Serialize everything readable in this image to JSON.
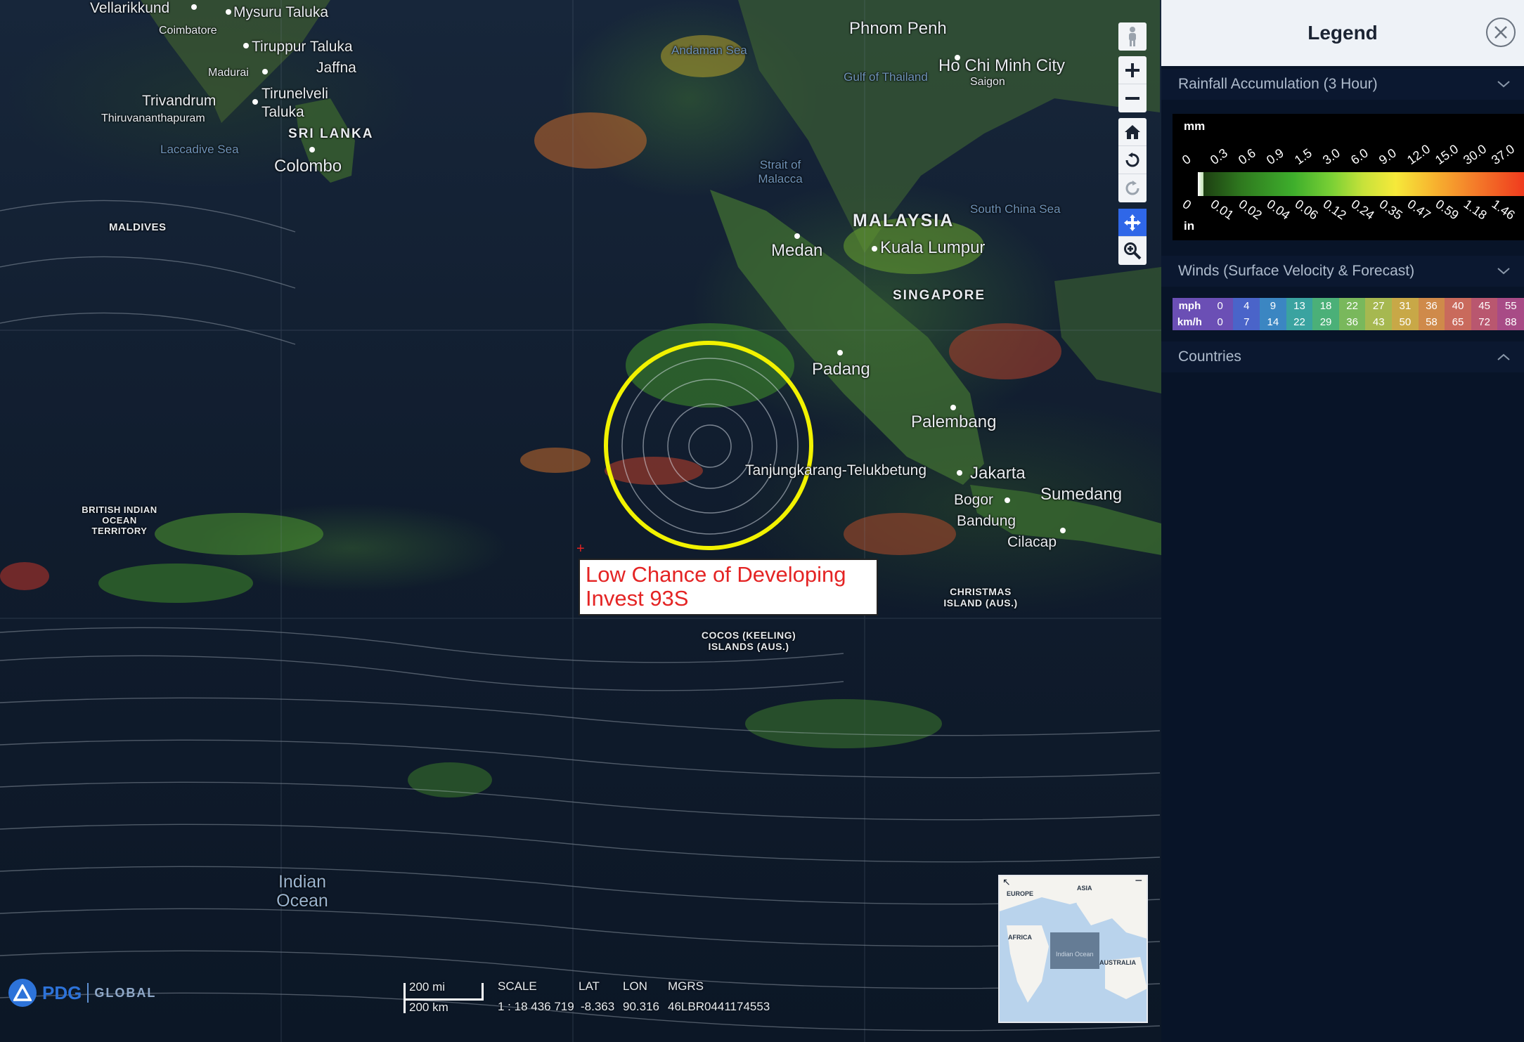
{
  "map": {
    "places": [
      {
        "id": "vellarikkund",
        "text": "Vellarikkund"
      },
      {
        "id": "mysuru",
        "text": "Mysuru Taluka"
      },
      {
        "id": "coimbatore",
        "text": "Coimbatore"
      },
      {
        "id": "tiruppur",
        "text": "Tiruppur Taluka"
      },
      {
        "id": "jaffna",
        "text": "Jaffna"
      },
      {
        "id": "madurai",
        "text": "Madurai"
      },
      {
        "id": "trivandrum",
        "text": "Trivandrum"
      },
      {
        "id": "thiruvananthapuram",
        "text": "Thiruvananthapuram"
      },
      {
        "id": "tirunelveli",
        "text": "Tirunelveli"
      },
      {
        "id": "taluka",
        "text": "Taluka"
      },
      {
        "id": "srilanka",
        "text": "SRI LANKA"
      },
      {
        "id": "laccadive",
        "text": "Laccadive Sea"
      },
      {
        "id": "colombo",
        "text": "Colombo"
      },
      {
        "id": "maldives",
        "text": "MALDIVES"
      },
      {
        "id": "biot",
        "text": "BRITISH INDIAN OCEAN TERRITORY"
      },
      {
        "id": "phnompenh",
        "text": "Phnom Penh"
      },
      {
        "id": "hochiminh",
        "text": "Ho Chi Minh City"
      },
      {
        "id": "saigon",
        "text": "Saigon"
      },
      {
        "id": "andaman",
        "text": "Andaman Sea"
      },
      {
        "id": "gulfthailand",
        "text": "Gulf of Thailand"
      },
      {
        "id": "malacca",
        "text": "Strait of Malacca"
      },
      {
        "id": "malaysia",
        "text": "MALAYSIA"
      },
      {
        "id": "southchinasea",
        "text": "South China Sea"
      },
      {
        "id": "medan",
        "text": "Medan"
      },
      {
        "id": "kualalumpur",
        "text": "Kuala Lumpur"
      },
      {
        "id": "singapore",
        "text": "SINGAPORE"
      },
      {
        "id": "padang",
        "text": "Padang"
      },
      {
        "id": "palembang",
        "text": "Palembang"
      },
      {
        "id": "tanjung",
        "text": "Tanjungkarang-Telukbetung"
      },
      {
        "id": "jakarta",
        "text": "Jakarta"
      },
      {
        "id": "sumedang",
        "text": "Sumedang"
      },
      {
        "id": "bogor",
        "text": "Bogor"
      },
      {
        "id": "bandung",
        "text": "Bandung"
      },
      {
        "id": "cilacap",
        "text": "Cilacap"
      },
      {
        "id": "christmas",
        "text": "CHRISTMAS ISLAND (AUS.)"
      },
      {
        "id": "cocos",
        "text": "COCOS (KEELING) ISLANDS (AUS.)"
      },
      {
        "id": "indianocean",
        "text": "Indian Ocean"
      }
    ],
    "annotation": {
      "line1": "Low Chance of Developing",
      "line2": "Invest 93S",
      "color": "#e42424"
    },
    "storm_circle_color": "#f2f200",
    "toolbar": [
      "person-icon",
      "zoom-in-icon",
      "zoom-out-icon",
      "home-icon",
      "rotate-left-icon",
      "rotate-right-icon",
      "pan-icon",
      "zoom-box-icon"
    ],
    "scale": {
      "mi": "200 mi",
      "km": "200 km",
      "scale_label": "SCALE",
      "scale_value": "1 : 18 436 719"
    },
    "coords": {
      "lat_label": "LAT",
      "lat": "-8.363",
      "lon_label": "LON",
      "lon": "90.316",
      "mgrs_label": "MGRS",
      "mgrs": "46LBR0441174553"
    },
    "logo": {
      "pdg": "PDG",
      "global": "GLOBAL"
    },
    "overview": {
      "europe": "EUROPE",
      "asia": "ASIA",
      "africa": "AFRICA",
      "indian_ocean": "Indian Ocean",
      "australia": "AUSTRALIA"
    }
  },
  "legend": {
    "title": "Legend",
    "sections": [
      {
        "label": "Rainfall Accumulation (3 Hour)",
        "state": "expanded"
      },
      {
        "label": "Winds (Surface Velocity & Forecast)",
        "state": "expanded"
      },
      {
        "label": "Countries",
        "state": "collapsed"
      }
    ],
    "rain": {
      "unit_top": "mm",
      "unit_bottom": "in",
      "mm": [
        "0",
        "0.3",
        "0.6",
        "0.9",
        "1.5",
        "3.0",
        "6.0",
        "9.0",
        "12.0",
        "15.0",
        "30.0",
        "37.0"
      ],
      "in": [
        "0",
        "0.01",
        "0.02",
        "0.04",
        "0.06",
        "0.12",
        "0.24",
        "0.35",
        "0.47",
        "0.59",
        "1.18",
        "1.46"
      ]
    },
    "wind": {
      "mph_label": "mph",
      "kmh_label": "km/h",
      "mph": [
        "0",
        "4",
        "9",
        "13",
        "18",
        "22",
        "27",
        "31",
        "36",
        "40",
        "45",
        "55"
      ],
      "kmh": [
        "0",
        "7",
        "14",
        "22",
        "29",
        "36",
        "43",
        "50",
        "58",
        "65",
        "72",
        "88"
      ],
      "colors": [
        "#6b4fb5",
        "#4a64c9",
        "#3b86c2",
        "#3aa3a0",
        "#4bb078",
        "#79b85c",
        "#a6b850",
        "#c8a847",
        "#cf8a4a",
        "#c96a5c",
        "#b9576f",
        "#a84b86"
      ]
    }
  }
}
